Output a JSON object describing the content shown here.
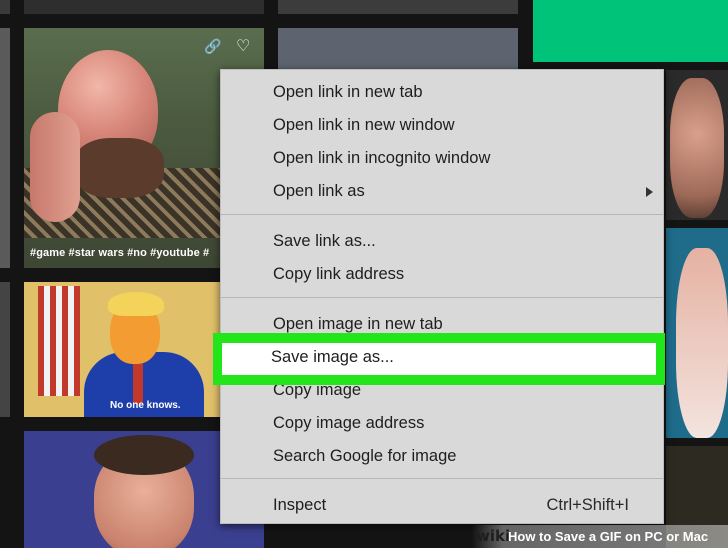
{
  "background_tiles": {
    "hashtags": "#game #star wars #no #youtube #",
    "cartoon_caption": "No one knows."
  },
  "context_menu": {
    "items": [
      {
        "label": "Open link in new tab"
      },
      {
        "label": "Open link in new window"
      },
      {
        "label": "Open link in incognito window"
      },
      {
        "label": "Open link as",
        "has_submenu": true
      },
      {
        "label": "Save link as..."
      },
      {
        "label": "Copy link address"
      },
      {
        "label": "Open image in new tab"
      },
      {
        "label": "Save image as...",
        "highlighted": true
      },
      {
        "label": "Copy image"
      },
      {
        "label": "Copy image address"
      },
      {
        "label": "Search Google for image"
      },
      {
        "label": "Inspect",
        "shortcut": "Ctrl+Shift+I"
      }
    ]
  },
  "highlight_color": "#22e619",
  "accent_color": "#00c37a",
  "watermark": {
    "logo": "wiki",
    "title": "How to Save a GIF on PC or Mac"
  }
}
